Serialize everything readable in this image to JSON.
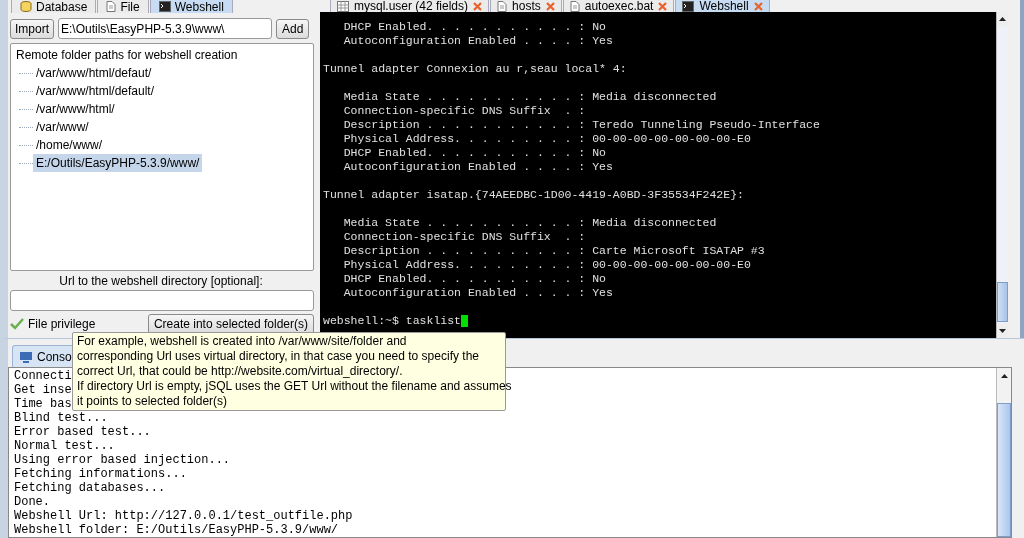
{
  "left_tabs": [
    {
      "label": "Database",
      "kind": "database",
      "selected": false
    },
    {
      "label": "File",
      "kind": "file",
      "selected": false
    },
    {
      "label": "Webshell",
      "kind": "terminal",
      "selected": true
    }
  ],
  "import_button": "Import",
  "path_field": {
    "value": "E:\\Outils\\EasyPHP-5.3.9\\www\\"
  },
  "add_button": "Add",
  "folder_tree": {
    "root": "Remote folder paths for webshell creation",
    "children": [
      {
        "label": "/var/www/html/defaut/",
        "selected": false
      },
      {
        "label": "/var/www/html/default/",
        "selected": false
      },
      {
        "label": "/var/www/html/",
        "selected": false
      },
      {
        "label": "/var/www/",
        "selected": false
      },
      {
        "label": "/home/www/",
        "selected": false
      },
      {
        "label": "E:/Outils/EasyPHP-5.3.9/www/",
        "selected": true
      }
    ]
  },
  "url_label": "Url to the webshell directory [optional]:",
  "file_privilege": {
    "label": "File privilege",
    "checked": true
  },
  "create_button": "Create into selected folder(s)",
  "editor_tabs": [
    {
      "label": "mysql.user (42 fields)",
      "kind": "table",
      "selected": false
    },
    {
      "label": "hosts",
      "kind": "file",
      "selected": false
    },
    {
      "label": "autoexec.bat",
      "kind": "file",
      "selected": false
    },
    {
      "label": "Webshell",
      "kind": "terminal",
      "selected": true
    }
  ],
  "terminal": {
    "blocks": [
      [
        "   DHCP Enabled. . . . . . . . . . . : No",
        "   Autoconfiguration Enabled . . . . : Yes"
      ],
      [
        "Tunnel adapter Connexion au r,seau local* 4:"
      ],
      [
        "   Media State . . . . . . . . . . . : Media disconnected",
        "   Connection-specific DNS Suffix  . :",
        "   Description . . . . . . . . . . . : Teredo Tunneling Pseudo-Interface",
        "   Physical Address. . . . . . . . . : 00-00-00-00-00-00-00-E0",
        "   DHCP Enabled. . . . . . . . . . . : No",
        "   Autoconfiguration Enabled . . . . : Yes"
      ],
      [
        "Tunnel adapter isatap.{74AEEDBC-1D00-4419-A0BD-3F35534F242E}:"
      ],
      [
        "   Media State . . . . . . . . . . . : Media disconnected",
        "   Connection-specific DNS Suffix  . :",
        "   Description . . . . . . . . . . . : Carte Microsoft ISATAP #3",
        "   Physical Address. . . . . . . . . : 00-00-00-00-00-00-00-E0",
        "   DHCP Enabled. . . . . . . . . . . : No",
        "   Autoconfiguration Enabled . . . . : Yes"
      ]
    ],
    "prompt": "webshell:~$ tasklist"
  },
  "console_tab": "Conso",
  "console_lines": [
    "Connecti",
    "Get inse",
    "Time bas",
    "Blind test...",
    "Error based test...",
    "Normal test...",
    "Using error based injection...",
    "Fetching informations...",
    "Fetching databases...",
    "Done.",
    "Webshell Url: http://127.0.0.1/test_outfile.php",
    "Webshell folder: E:/Outils/EasyPHP-5.3.9/www/"
  ],
  "tooltip": [
    "For example, webshell is created into /var/www/site/folder and",
    "corresponding Url uses virtual directory, in that case you need to specify the",
    "correct Url, that could be http://website.com/virtual_directory/.",
    "If directory Url is empty, jSQL uses the GET Url without the filename and assumes",
    "it points to selected folder(s)"
  ]
}
